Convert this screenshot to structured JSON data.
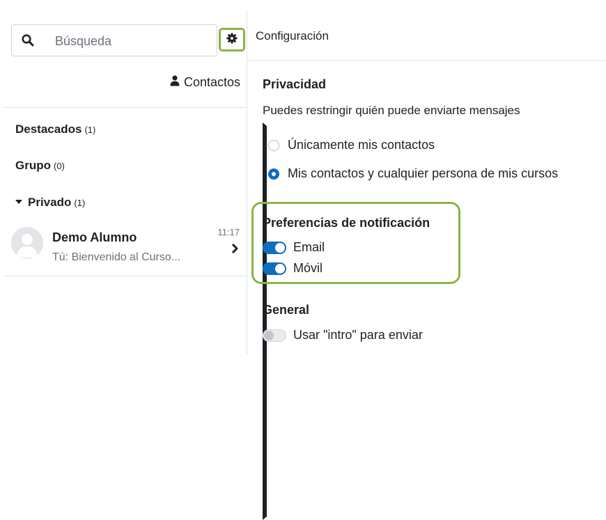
{
  "search": {
    "placeholder": "Búsqueda"
  },
  "contacts": {
    "label": "Contactos"
  },
  "sections": [
    {
      "name": "Destacados",
      "count": "(1)",
      "expanded": false
    },
    {
      "name": "Grupo",
      "count": "(0)",
      "expanded": false
    },
    {
      "name": "Privado",
      "count": "(1)",
      "expanded": true
    }
  ],
  "conversation": {
    "name": "Demo Alumno",
    "last_message": "Tú: Bienvenido al Curso...",
    "time": "11:17"
  },
  "settings": {
    "title": "Configuración",
    "privacy": {
      "heading": "Privacidad",
      "description": "Puedes restringir quién puede enviarte mensajes",
      "options": [
        {
          "label": "Únicamente mis contactos",
          "selected": false
        },
        {
          "label": "Mis contactos y cualquier persona de mis cursos",
          "selected": true
        }
      ]
    },
    "notifications": {
      "heading": "Preferencias de notificación",
      "toggles": [
        {
          "label": "Email",
          "on": true
        },
        {
          "label": "Móvil",
          "on": true
        }
      ]
    },
    "general": {
      "heading": "General",
      "enter_to_send": {
        "label": "Usar \"intro\" para enviar",
        "on": false
      }
    }
  },
  "colors": {
    "accent": "#0f6cbf",
    "highlight": "#8cb348"
  }
}
